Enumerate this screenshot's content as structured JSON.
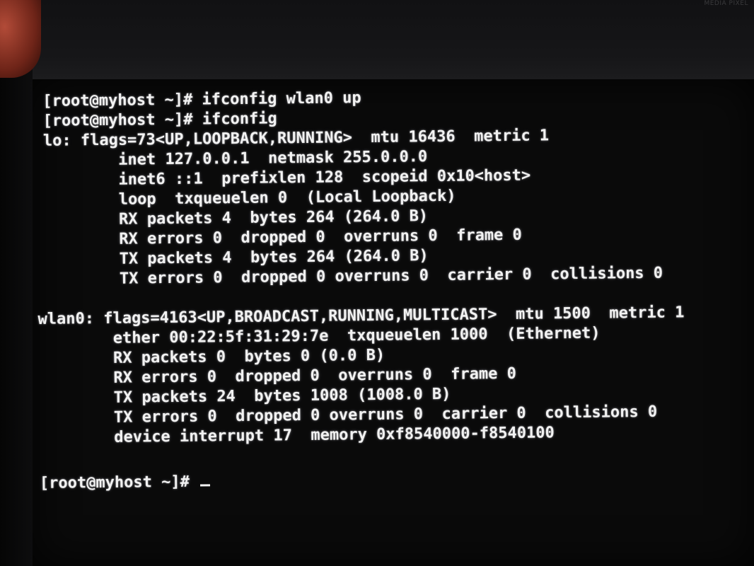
{
  "bezel": {
    "label": "MEDIA PIXEL"
  },
  "terminal": {
    "lines": [
      "[root@myhost ~]# ifconfig wlan0 up",
      "[root@myhost ~]# ifconfig",
      "lo: flags=73<UP,LOOPBACK,RUNNING>  mtu 16436  metric 1",
      "        inet 127.0.0.1  netmask 255.0.0.0",
      "        inet6 ::1  prefixlen 128  scopeid 0x10<host>",
      "        loop  txqueuelen 0  (Local Loopback)",
      "        RX packets 4  bytes 264 (264.0 B)",
      "        RX errors 0  dropped 0  overruns 0  frame 0",
      "        TX packets 4  bytes 264 (264.0 B)",
      "        TX errors 0  dropped 0 overruns 0  carrier 0  collisions 0",
      "",
      "wlan0: flags=4163<UP,BROADCAST,RUNNING,MULTICAST>  mtu 1500  metric 1",
      "        ether 00:22:5f:31:29:7e  txqueuelen 1000  (Ethernet)",
      "        RX packets 0  bytes 0 (0.0 B)",
      "        RX errors 0  dropped 0  overruns 0  frame 0",
      "        TX packets 24  bytes 1008 (1008.0 B)",
      "        TX errors 0  dropped 0 overruns 0  carrier 0  collisions 0",
      "        device interrupt 17  memory 0xf8540000-f8540100",
      "",
      "[root@myhost ~]# "
    ]
  }
}
